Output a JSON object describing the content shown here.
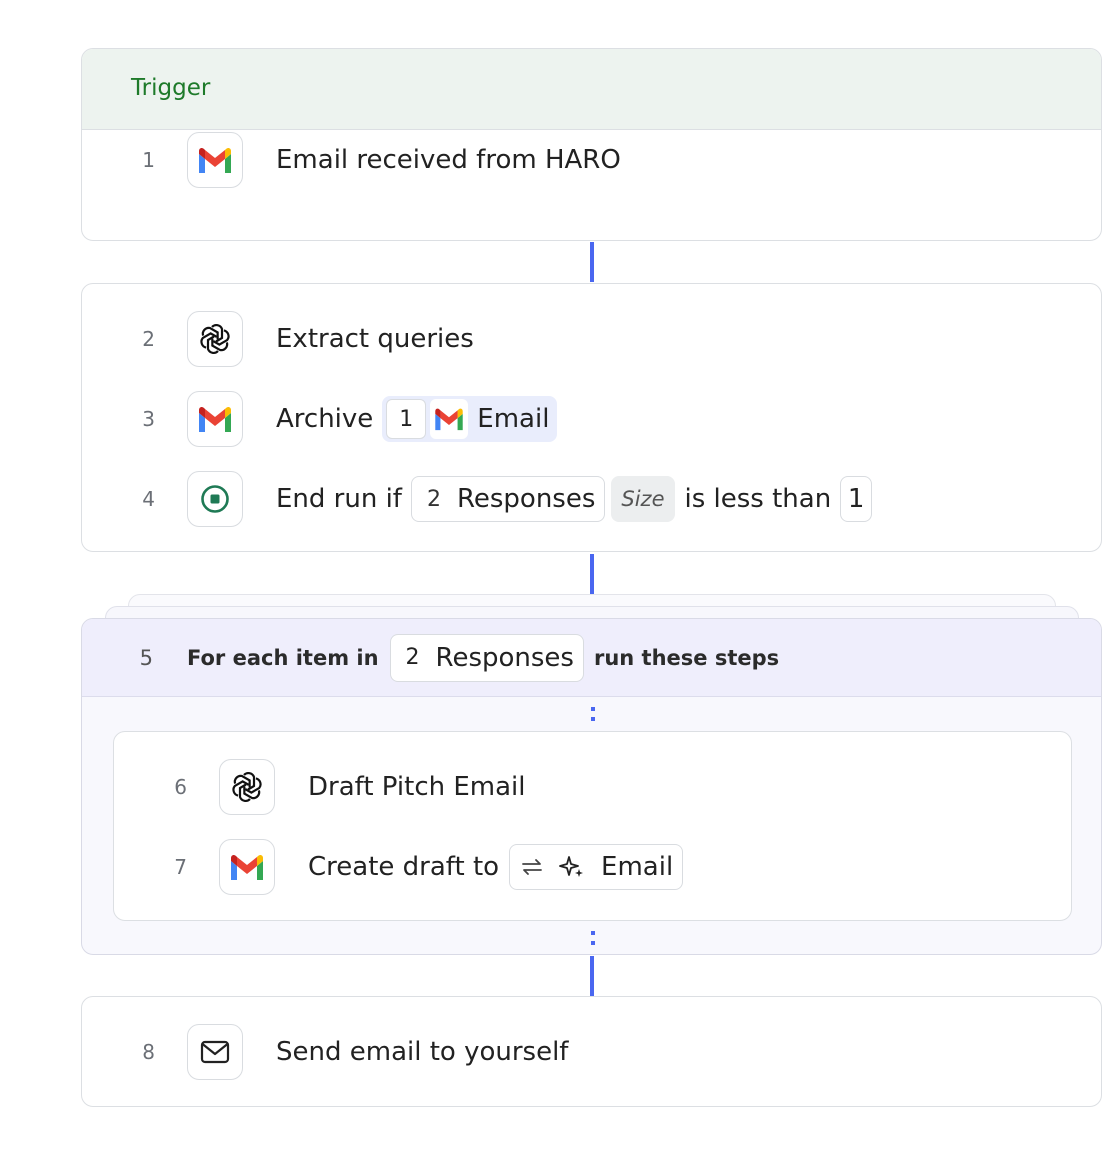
{
  "trigger": {
    "header": "Trigger",
    "step": {
      "number": "1",
      "icon": "gmail-icon",
      "label": "Email received from HARO"
    }
  },
  "group1": {
    "step2": {
      "number": "2",
      "icon": "openai-icon",
      "label": "Extract queries"
    },
    "step3": {
      "number": "3",
      "icon": "gmail-icon",
      "label": "Archive",
      "ref_number": "1",
      "ref_label": "Email"
    },
    "step4": {
      "number": "4",
      "icon": "stop-icon",
      "label": "End run if",
      "ref_number": "2",
      "ref_label": "Responses",
      "modifier": "Size",
      "operator": "is less than",
      "value": "1"
    }
  },
  "loop": {
    "number": "5",
    "prefix": "For each item in",
    "ref_number": "2",
    "ref_label": "Responses",
    "suffix": "run these steps",
    "step6": {
      "number": "6",
      "icon": "openai-icon",
      "label": "Draft Pitch Email"
    },
    "step7": {
      "number": "7",
      "icon": "gmail-icon",
      "label": "Create draft to",
      "ref_label": "Email"
    }
  },
  "step8": {
    "number": "8",
    "icon": "mail-icon",
    "label": "Send email to yourself"
  },
  "colors": {
    "connector": "#4a67f0",
    "trigger_text": "#1e7a2a",
    "trigger_bg": "#edf3ef",
    "loop_bg": "#efeefc",
    "stop_icon": "#1f7a55"
  }
}
